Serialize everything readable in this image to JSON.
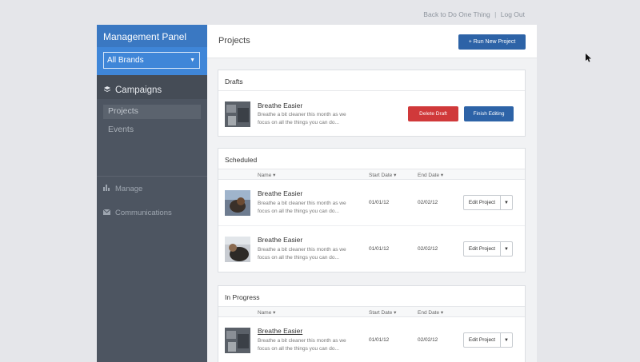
{
  "top_links": {
    "back": "Back to Do One Thing",
    "separator": "|",
    "logout": "Log Out"
  },
  "sidebar": {
    "header": "Management Panel",
    "brand_select": "All Brands",
    "section": "Campaigns",
    "sub_items": [
      {
        "label": "Projects",
        "active": true
      },
      {
        "label": "Events",
        "active": false
      }
    ],
    "links": [
      {
        "label": "Manage",
        "icon": "bar-chart-icon"
      },
      {
        "label": "Communications",
        "icon": "envelope-icon"
      }
    ]
  },
  "main": {
    "title": "Projects",
    "run_button": "+ Run New Project"
  },
  "columns": {
    "name": "Name",
    "start": "Start Date",
    "end": "End Date",
    "sort_glyph": "▾"
  },
  "drafts": {
    "title": "Drafts",
    "items": [
      {
        "name": "Breathe Easier",
        "desc": "Breathe a bit cleaner this month as we focus on all the things you can do...",
        "delete_label": "Delete Draft",
        "finish_label": "Finish Editing"
      }
    ]
  },
  "scheduled": {
    "title": "Scheduled",
    "items": [
      {
        "name": "Breathe Easier",
        "desc": "Breathe a bit cleaner this month as we focus on all the things you can do...",
        "start": "01/01/12",
        "end": "02/02/12",
        "edit_label": "Edit Project"
      },
      {
        "name": "Breathe Easier",
        "desc": "Breathe a bit cleaner this month as we focus on all the things you can do...",
        "start": "01/01/12",
        "end": "02/02/12",
        "edit_label": "Edit Project"
      }
    ]
  },
  "in_progress": {
    "title": "In Progress",
    "items": [
      {
        "name": "Breathe Easier",
        "desc": "Breathe a bit cleaner this month as we focus on all the things you can do...",
        "start": "01/01/12",
        "end": "02/02/12",
        "edit_label": "Edit Project"
      }
    ]
  },
  "colors": {
    "sidebar_header": "#3a78c2",
    "sidebar_bg": "#4d5561",
    "primary_button": "#2d63a7",
    "danger_button": "#d0393a"
  }
}
